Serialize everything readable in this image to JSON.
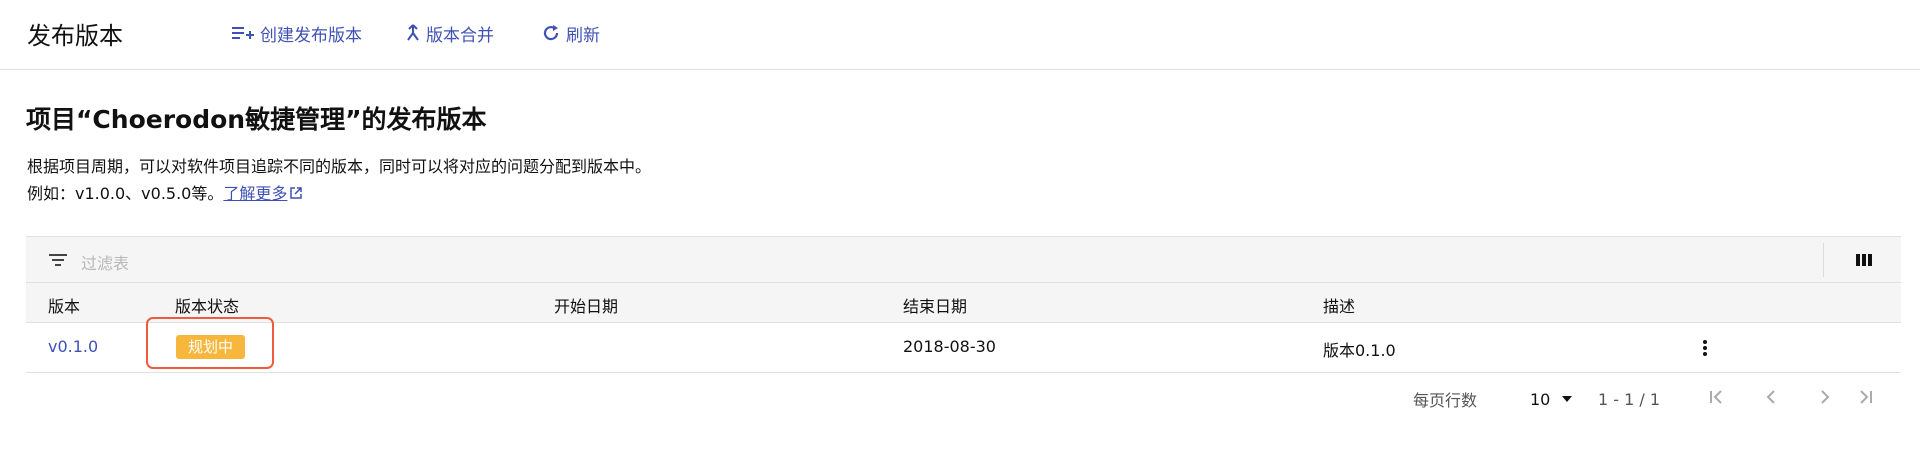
{
  "header": {
    "title": "发布版本",
    "create_label": "创建发布版本",
    "merge_label": "版本合并",
    "refresh_label": "刷新"
  },
  "content": {
    "title": "项目“Choerodon敏捷管理”的发布版本",
    "desc_line1": "根据项目周期，可以对软件项目追踪不同的版本，同时可以将对应的问题分配到版本中。",
    "desc_line2_prefix": "例如：v1.0.0、v0.5.0等。",
    "learn_more": "了解更多"
  },
  "filter": {
    "placeholder": "过滤表"
  },
  "table": {
    "columns": [
      "版本",
      "版本状态",
      "开始日期",
      "结束日期",
      "描述"
    ],
    "rows": [
      {
        "version": "v0.1.0",
        "status": "规划中",
        "start_date": "",
        "end_date": "2018-08-30",
        "description": "版本0.1.0"
      }
    ]
  },
  "pagination": {
    "rows_per_page_label": "每页行数",
    "rows_per_page": "10",
    "range": "1 - 1 / 1"
  },
  "colors": {
    "accent": "#3f51b5",
    "status_badge": "#f7b73d",
    "highlight_box": "#ef5b3f"
  },
  "icons": {
    "create": "playlist-add-icon",
    "merge": "merge-icon",
    "refresh": "refresh-icon",
    "filter": "filter-list-icon",
    "columns": "view-column-icon",
    "more": "more-vert-icon",
    "link": "open-in-new-icon"
  }
}
